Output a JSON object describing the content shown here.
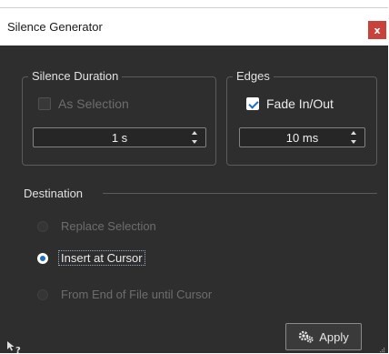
{
  "window": {
    "title": "Silence Generator",
    "close_glyph": "x"
  },
  "silence_duration": {
    "legend": "Silence Duration",
    "as_selection": {
      "label": "As Selection",
      "checked": false,
      "enabled": false
    },
    "duration_value": "1 s"
  },
  "edges": {
    "legend": "Edges",
    "fade": {
      "label": "Fade In/Out",
      "checked": true,
      "enabled": true
    },
    "fade_value": "10 ms"
  },
  "destination": {
    "legend": "Destination",
    "options": [
      {
        "label": "Replace Selection",
        "selected": false,
        "enabled": false
      },
      {
        "label": "Insert at Cursor",
        "selected": true,
        "enabled": true
      },
      {
        "label": "From End of File until Cursor",
        "selected": false,
        "enabled": false
      }
    ]
  },
  "footer": {
    "apply_label": "Apply",
    "apply_icon": "gears-icon",
    "help_icon": "whats-this-icon",
    "grip_icon": "resize-grip-icon"
  },
  "colors": {
    "background": "#2e2e2e",
    "close_button": "#c8413b",
    "accent": "#1e6fc0"
  }
}
